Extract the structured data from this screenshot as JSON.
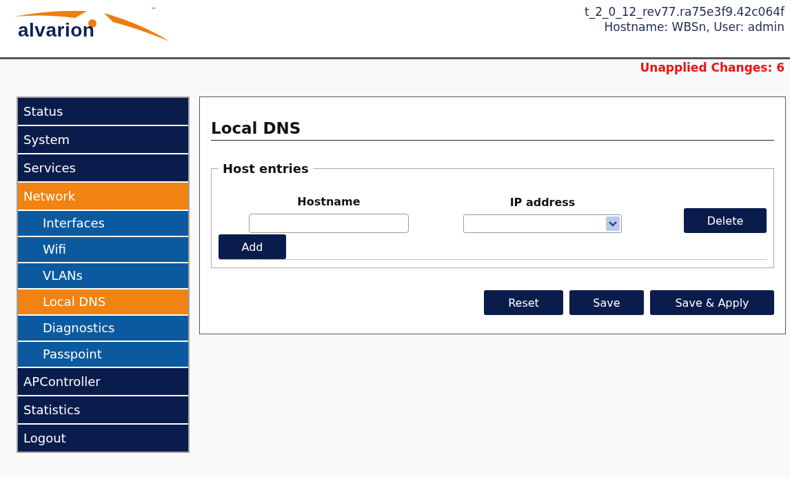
{
  "logo": {
    "text": "alvarion",
    "mark": "™"
  },
  "header": {
    "version": "t_2_0_12_rev77.ra75e3f9.42c064f",
    "session": "Hostname: WBSn, User: admin"
  },
  "unapplied_changes": "Unapplied Changes: 6",
  "sidebar": {
    "items": [
      {
        "label": "Status",
        "selected": false
      },
      {
        "label": "System",
        "selected": false
      },
      {
        "label": "Services",
        "selected": false
      },
      {
        "label": "Network",
        "selected": true,
        "children": [
          {
            "label": "Interfaces",
            "selected": false
          },
          {
            "label": "Wifi",
            "selected": false
          },
          {
            "label": "VLANs",
            "selected": false
          },
          {
            "label": "Local DNS",
            "selected": true
          },
          {
            "label": "Diagnostics",
            "selected": false
          },
          {
            "label": "Passpoint",
            "selected": false
          }
        ]
      },
      {
        "label": "APController",
        "selected": false
      },
      {
        "label": "Statistics",
        "selected": false
      },
      {
        "label": "Logout",
        "selected": false
      }
    ]
  },
  "page": {
    "title": "Local DNS",
    "fieldset": {
      "legend": "Host entries",
      "columns": [
        "Hostname",
        "IP address"
      ],
      "delete_button": "Delete",
      "add_button": "Add"
    },
    "buttons": [
      "Reset",
      "Save",
      "Save & Apply"
    ]
  }
}
